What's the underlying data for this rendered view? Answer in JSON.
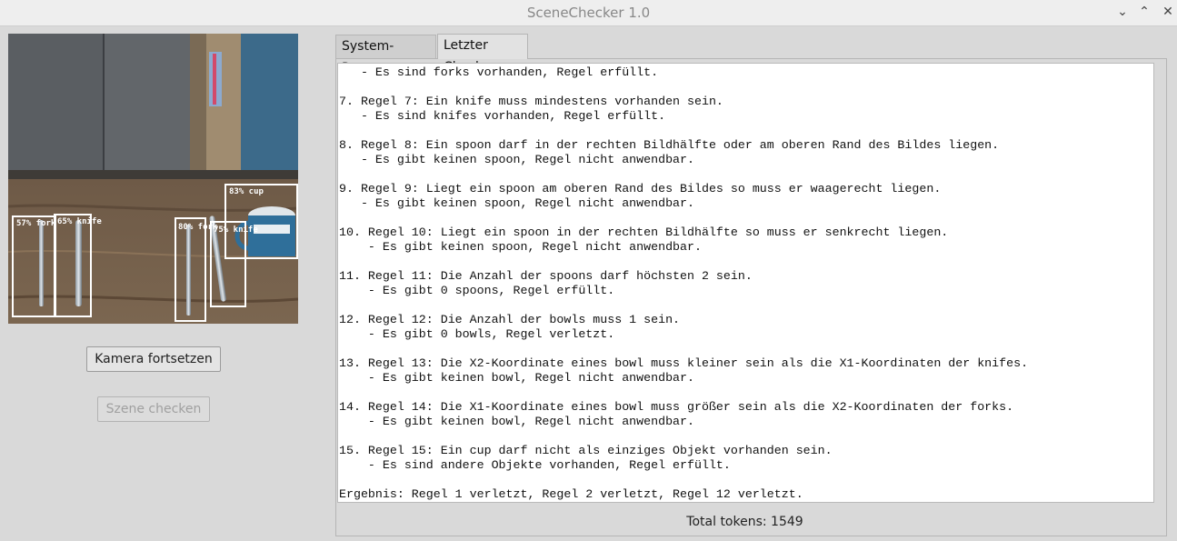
{
  "window": {
    "title": "SceneChecker 1.0",
    "controls": [
      "⌄",
      "⌃",
      "✕"
    ]
  },
  "camera": {
    "detections": [
      {
        "label": "57% fork"
      },
      {
        "label": "65% knife"
      },
      {
        "label": "80% fork"
      },
      {
        "label": "75% knife"
      },
      {
        "label": "83% cup"
      }
    ]
  },
  "buttons": {
    "resume_camera": "Kamera fortsetzen",
    "check_scene": "Szene checken"
  },
  "tabs": [
    {
      "label": "System-Prompt"
    },
    {
      "label": "Letzter Check"
    }
  ],
  "output": {
    "text": "   - Es sind forks vorhanden, Regel erfüllt.\n\n7. Regel 7: Ein knife muss mindestens vorhanden sein.\n   - Es sind knifes vorhanden, Regel erfüllt.\n\n8. Regel 8: Ein spoon darf in der rechten Bildhälfte oder am oberen Rand des Bildes liegen.\n   - Es gibt keinen spoon, Regel nicht anwendbar.\n\n9. Regel 9: Liegt ein spoon am oberen Rand des Bildes so muss er waagerecht liegen.\n   - Es gibt keinen spoon, Regel nicht anwendbar.\n\n10. Regel 10: Liegt ein spoon in der rechten Bildhälfte so muss er senkrecht liegen.\n    - Es gibt keinen spoon, Regel nicht anwendbar.\n\n11. Regel 11: Die Anzahl der spoons darf höchsten 2 sein.\n    - Es gibt 0 spoons, Regel erfüllt.\n\n12. Regel 12: Die Anzahl der bowls muss 1 sein.\n    - Es gibt 0 bowls, Regel verletzt.\n\n13. Regel 13: Die X2-Koordinate eines bowl muss kleiner sein als die X1-Koordinaten der knifes.\n    - Es gibt keinen bowl, Regel nicht anwendbar.\n\n14. Regel 14: Die X1-Koordinate eines bowl muss größer sein als die X2-Koordinaten der forks.\n    - Es gibt keinen bowl, Regel nicht anwendbar.\n\n15. Regel 15: Ein cup darf nicht als einziges Objekt vorhanden sein.\n    - Es sind andere Objekte vorhanden, Regel erfüllt.\n\nErgebnis: Regel 1 verletzt, Regel 2 verletzt, Regel 12 verletzt.",
    "total_tokens": "Total tokens: 1549"
  }
}
